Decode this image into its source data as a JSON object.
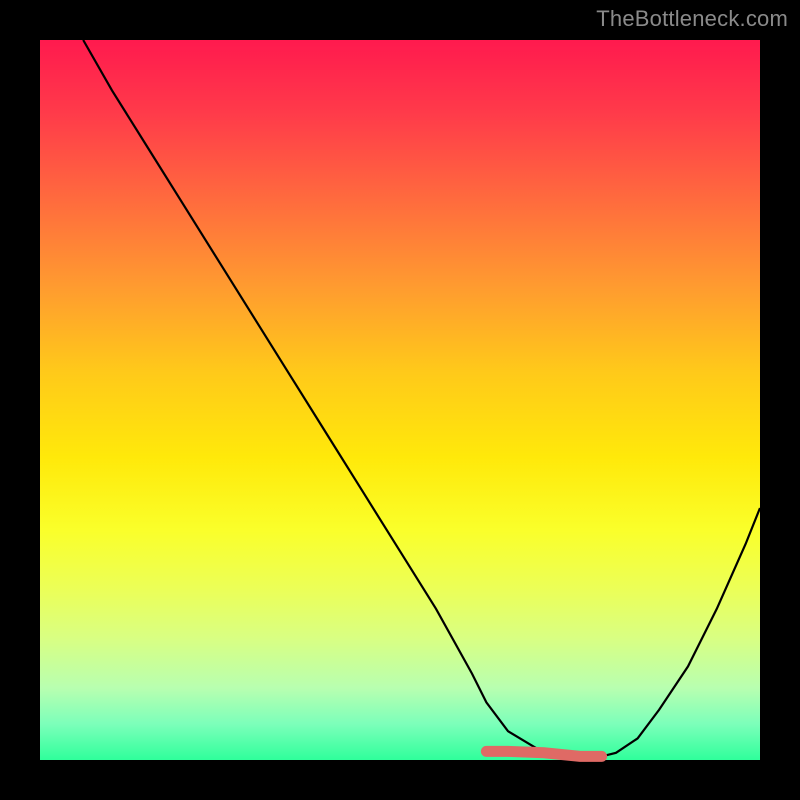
{
  "watermark": "TheBottleneck.com",
  "chart_data": {
    "type": "line",
    "title": "",
    "xlabel": "",
    "ylabel": "",
    "xlim": [
      0,
      100
    ],
    "ylim": [
      0,
      100
    ],
    "grid": false,
    "series": [
      {
        "name": "curve",
        "x": [
          6,
          10,
          15,
          20,
          25,
          30,
          35,
          40,
          45,
          50,
          55,
          60,
          62,
          65,
          70,
          75,
          78,
          80,
          83,
          86,
          90,
          94,
          98,
          100
        ],
        "y": [
          100,
          93,
          85,
          77,
          69,
          61,
          53,
          45,
          37,
          29,
          21,
          12,
          8,
          4,
          1,
          0.5,
          0.5,
          1,
          3,
          7,
          13,
          21,
          30,
          35
        ]
      }
    ],
    "highlight_range_x": [
      62,
      78
    ],
    "background_gradient": {
      "top": "#ff1a4e",
      "bottom": "#2fff9b"
    }
  }
}
